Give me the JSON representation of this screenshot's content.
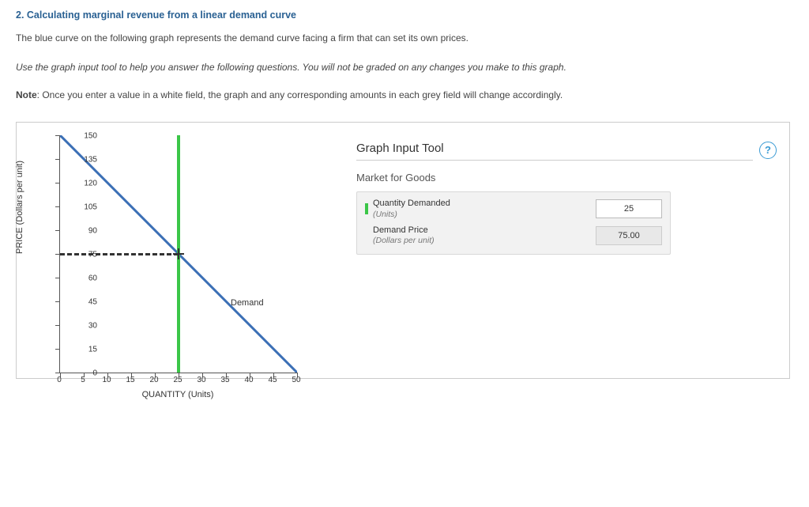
{
  "heading": "2. Calculating marginal revenue from a linear demand curve",
  "intro": "The blue curve on the following graph represents the demand curve facing a firm that can set its own prices.",
  "instruction": "Use the graph input tool to help you answer the following questions. You will not be graded on any changes you make to this graph.",
  "note_label": "Note",
  "note_text": ": Once you enter a value in a white field, the graph and any corresponding amounts in each grey field will change accordingly.",
  "tool": {
    "title": "Graph Input Tool",
    "section": "Market for Goods",
    "rows": {
      "qty": {
        "label_main": "Quantity Demanded",
        "label_sub": "(Units)",
        "value": "25"
      },
      "price": {
        "label_main": "Demand Price",
        "label_sub": "(Dollars per unit)",
        "value": "75.00"
      }
    }
  },
  "chart_data": {
    "type": "line",
    "title": "",
    "xlabel": "QUANTITY (Units)",
    "ylabel": "PRICE (Dollars per unit)",
    "xlim": [
      0,
      50
    ],
    "ylim": [
      0,
      150
    ],
    "xticks": [
      0,
      5,
      10,
      15,
      20,
      25,
      30,
      35,
      40,
      45,
      50
    ],
    "yticks": [
      0,
      15,
      30,
      45,
      60,
      75,
      90,
      105,
      120,
      135,
      150
    ],
    "series": [
      {
        "name": "Demand",
        "color": "#3b6fb5",
        "x": [
          0,
          50
        ],
        "y": [
          150,
          0
        ]
      }
    ],
    "marker": {
      "quantity": 25,
      "price": 75
    }
  }
}
